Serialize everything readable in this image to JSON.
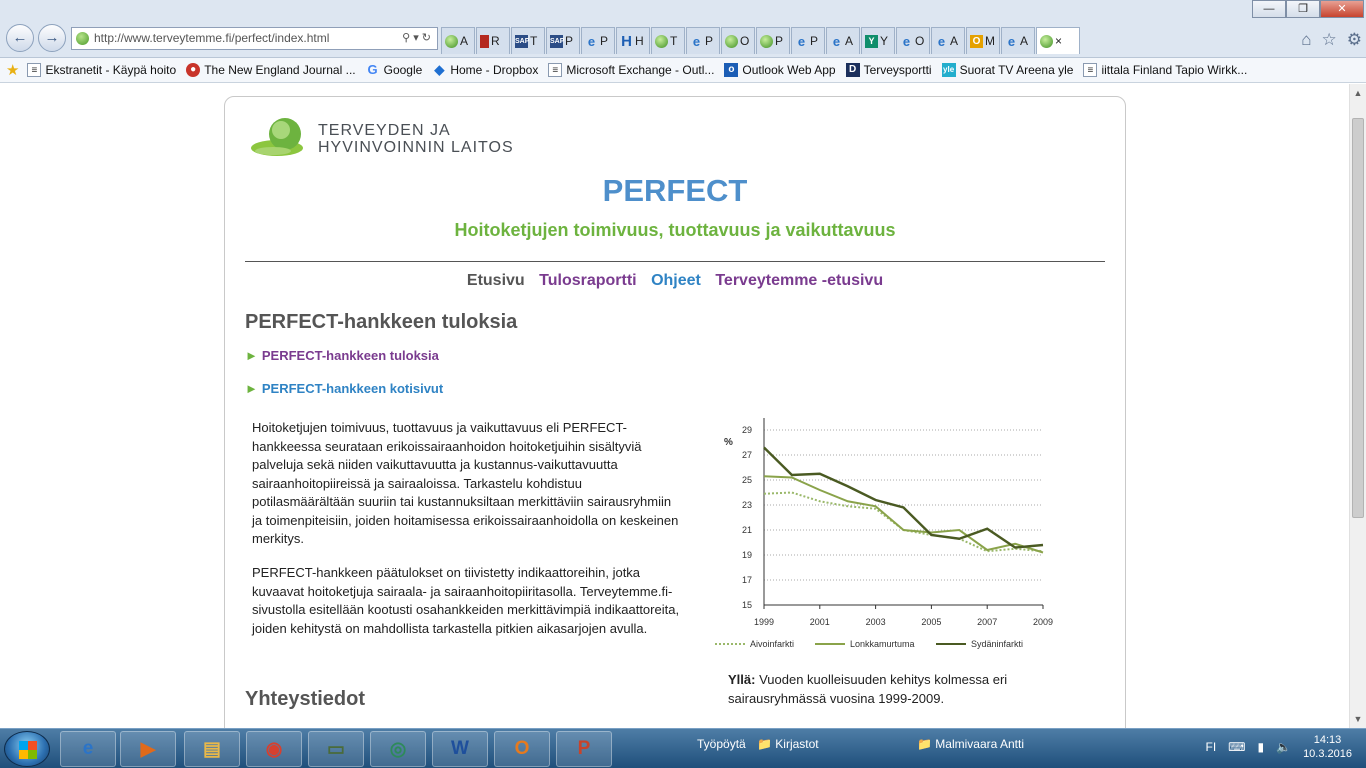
{
  "browser": {
    "url": "http://www.terveytemme.fi/perfect/index.html",
    "controls": {
      "minimize": "—",
      "maximize": "❐",
      "close": "✕"
    },
    "tabs": [
      {
        "label": "A",
        "icon": "globe-icon"
      },
      {
        "label": "R",
        "icon": "red-page-icon"
      },
      {
        "label": "T",
        "icon": "sap-icon"
      },
      {
        "label": "P",
        "icon": "sap-icon"
      },
      {
        "label": "P",
        "icon": "ie-icon"
      },
      {
        "label": "H",
        "icon": "h-icon"
      },
      {
        "label": "T",
        "icon": "globe-icon"
      },
      {
        "label": "P",
        "icon": "ie-icon"
      },
      {
        "label": "O",
        "icon": "globe-icon"
      },
      {
        "label": "P",
        "icon": "globe-icon"
      },
      {
        "label": "P",
        "icon": "ie-icon"
      },
      {
        "label": "A",
        "icon": "ie-icon"
      },
      {
        "label": "Y",
        "icon": "yammer-icon"
      },
      {
        "label": "O",
        "icon": "ie-icon"
      },
      {
        "label": "A",
        "icon": "ie-icon"
      },
      {
        "label": "M",
        "icon": "o-icon"
      },
      {
        "label": "A",
        "icon": "ie-icon"
      },
      {
        "label": "×",
        "icon": "globe-icon"
      }
    ],
    "favorites": [
      {
        "label": "Ekstranetit - Käypä hoito",
        "icon": "page"
      },
      {
        "label": "The New England Journal ...",
        "icon": "nejm"
      },
      {
        "label": "Google",
        "icon": "g"
      },
      {
        "label": "Home - Dropbox",
        "icon": "db"
      },
      {
        "label": "Microsoft Exchange - Outl...",
        "icon": "page"
      },
      {
        "label": "Outlook Web App",
        "icon": "ol"
      },
      {
        "label": "Terveysportti",
        "icon": "d"
      },
      {
        "label": "Suorat  TV  Areena  yle",
        "icon": "yle"
      },
      {
        "label": "iittala Finland Tapio Wirkk...",
        "icon": "page"
      }
    ]
  },
  "site": {
    "logo_line1": "TERVEYDEN JA",
    "logo_line2": "HYVINVOINNIN LAITOS",
    "title": "PERFECT",
    "subtitle": "Hoitoketjujen toimivuus, tuottavuus ja vaikuttavuus",
    "menu": {
      "home": "Etusivu",
      "report": "Tulosraportti",
      "help": "Ohjeet",
      "terveytemme": "Terveytemme -etusivu"
    },
    "heading": "PERFECT-hankkeen tuloksia",
    "links": [
      "PERFECT-hankkeen tuloksia",
      "PERFECT-hankkeen kotisivut"
    ],
    "para1": "Hoitoketjujen toimivuus, tuottavuus ja vaikuttavuus eli PERFECT-hankkeessa seurataan erikoissairaanhoidon hoitoketjuihin sisältyviä palveluja sekä niiden vaikuttavuutta ja kustannus-vaikuttavuutta sairaanhoitopiireissä ja sairaaloissa. Tarkastelu kohdistuu potilasmäärältään suuriin tai kustannuksiltaan merkittäviin sairausryhmiin ja toimenpiteisiin, joiden hoitamisessa erikoissairaanhoidolla on keskeinen merkitys.",
    "para2": "PERFECT-hankkeen päätulokset on tiivistetty indikaattoreihin, jotka kuvaavat hoitoketjuja sairaala- ja sairaanhoitopiiritasolla. Terveytemme.fi-sivustolla esitellään kootusti osahankkeiden merkittävimpiä indikaattoreita, joiden kehitystä on mahdollista tarkastella pitkien aikasarjojen avulla.",
    "caption_bold": "Yllä:",
    "caption_text": " Vuoden kuolleisuuden kehitys kolmessa eri sairausryhmässä vuosina 1999-2009.",
    "contact_heading": "Yhteystiedot"
  },
  "chart_data": {
    "type": "line",
    "ylabel": "%",
    "x": [
      1999,
      2000,
      2001,
      2002,
      2003,
      2004,
      2005,
      2006,
      2007,
      2008,
      2009
    ],
    "xticks": [
      "1999",
      "2001",
      "2003",
      "2005",
      "2007",
      "2009"
    ],
    "yticks": [
      "29",
      "27",
      "25",
      "23",
      "21",
      "19",
      "17",
      "15"
    ],
    "ylim": [
      15,
      29
    ],
    "grid": true,
    "legend_position": "bottom",
    "series": [
      {
        "name": "Aivoinfarkti",
        "color": "#9ab86a",
        "dash": true,
        "values": [
          23.9,
          24.0,
          23.3,
          22.9,
          22.7,
          21.0,
          20.6,
          20.3,
          19.3,
          19.5,
          19.3
        ]
      },
      {
        "name": "Lonkkamurtuma",
        "color": "#8aa34a",
        "dash": false,
        "values": [
          25.3,
          25.2,
          24.2,
          23.3,
          22.9,
          21.0,
          20.8,
          21.0,
          19.4,
          19.9,
          19.2
        ]
      },
      {
        "name": "Sydäninfarkti",
        "color": "#4a5a22",
        "dash": false,
        "values": [
          27.6,
          25.4,
          25.5,
          24.5,
          23.4,
          22.8,
          20.6,
          20.3,
          21.1,
          19.6,
          19.8
        ]
      }
    ]
  },
  "taskbar": {
    "apps": [
      "ie-icon",
      "media-player-icon",
      "explorer-icon",
      "chrome-icon",
      "monitor-icon",
      "network-icon",
      "word-icon",
      "outlook-icon",
      "powerpoint-icon"
    ],
    "toolbar1": "Työpöytä",
    "toolbar2": "Kirjastot",
    "toolbar3": "Malmivaara Antti",
    "lang": "FI",
    "time": "14:13",
    "date": "10.3.2016"
  }
}
